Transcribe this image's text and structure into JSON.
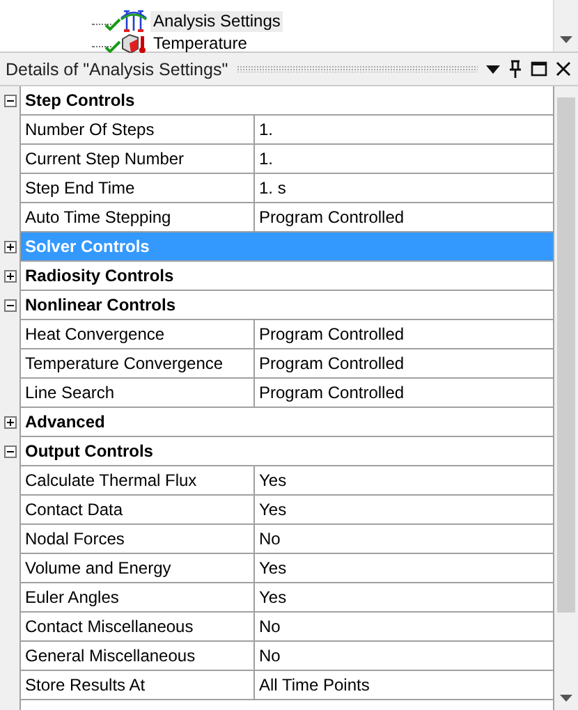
{
  "tree": {
    "items": [
      {
        "label": "Analysis Settings",
        "kind": "settings",
        "checked": true,
        "selected": true
      },
      {
        "label": "Temperature",
        "kind": "temperature",
        "checked": true,
        "selected": false
      }
    ]
  },
  "details": {
    "title": "Details of \"Analysis Settings\"",
    "sections": [
      {
        "title": "Step Controls",
        "expanded": true,
        "selected": false,
        "rows": [
          {
            "name": "Number Of Steps",
            "value": "1."
          },
          {
            "name": "Current Step Number",
            "value": "1."
          },
          {
            "name": "Step End Time",
            "value": "1. s"
          },
          {
            "name": "Auto Time Stepping",
            "value": "Program Controlled"
          }
        ]
      },
      {
        "title": "Solver Controls",
        "expanded": false,
        "selected": true
      },
      {
        "title": "Radiosity Controls",
        "expanded": false,
        "selected": false
      },
      {
        "title": "Nonlinear Controls",
        "expanded": true,
        "selected": false,
        "rows": [
          {
            "name": "Heat Convergence",
            "value": "Program Controlled"
          },
          {
            "name": "Temperature Convergence",
            "value": "Program Controlled"
          },
          {
            "name": "Line Search",
            "value": "Program Controlled"
          }
        ]
      },
      {
        "title": "Advanced",
        "expanded": false,
        "selected": false
      },
      {
        "title": "Output Controls",
        "expanded": true,
        "selected": false,
        "rows": [
          {
            "name": "Calculate Thermal Flux",
            "value": "Yes"
          },
          {
            "name": "Contact Data",
            "value": "Yes"
          },
          {
            "name": "Nodal Forces",
            "value": "No"
          },
          {
            "name": "Volume and Energy",
            "value": "Yes"
          },
          {
            "name": "Euler Angles",
            "value": "Yes"
          },
          {
            "name": "Contact Miscellaneous",
            "value": "No"
          },
          {
            "name": "General Miscellaneous",
            "value": "No"
          },
          {
            "name": "Store Results At",
            "value": "All Time Points"
          }
        ]
      }
    ]
  }
}
